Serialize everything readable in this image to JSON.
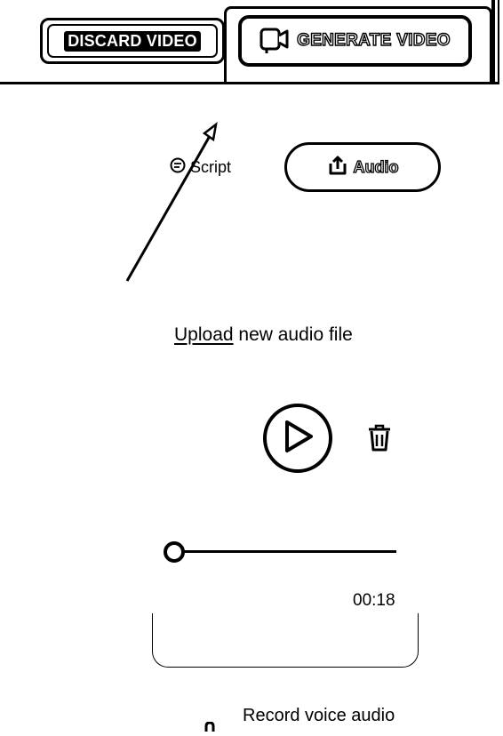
{
  "toolbar": {
    "discard_label": "DISCARD VIDEO",
    "generate_label": "GENERATE VIDEO"
  },
  "tabs": {
    "script_label": "Script",
    "audio_label": "Audio",
    "active": "Audio"
  },
  "upload": {
    "link_label": "Upload",
    "rest_label": " new audio file"
  },
  "player": {
    "elapsed": "00:18",
    "progress": 0.0
  },
  "record": {
    "label": "Record voice audio"
  },
  "icons": {
    "generate": "video-generate-icon",
    "script": "chat-bubble-icon",
    "audio": "upload-icon",
    "play": "play-icon",
    "delete": "trash-icon",
    "record": "microphone-icon"
  }
}
